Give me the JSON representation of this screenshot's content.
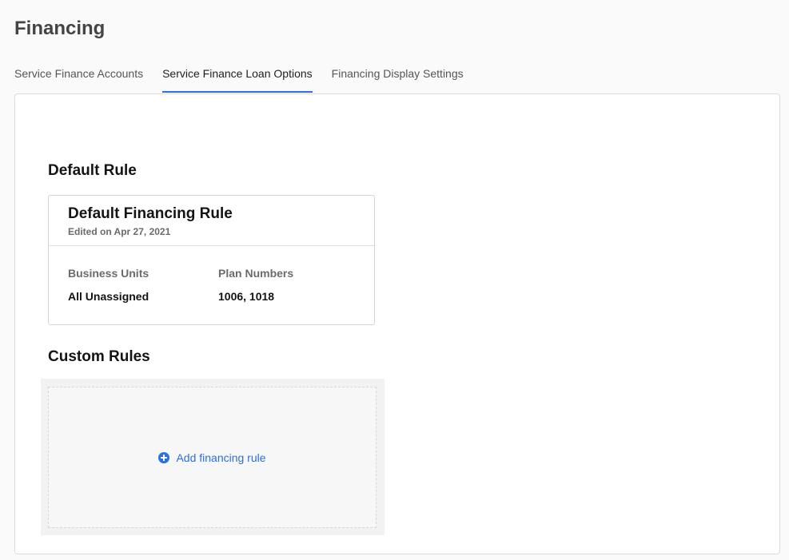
{
  "page": {
    "title": "Financing"
  },
  "tabs": [
    {
      "label": "Service Finance Accounts",
      "active": false
    },
    {
      "label": "Service Finance Loan Options",
      "active": true
    },
    {
      "label": "Financing Display Settings",
      "active": false
    }
  ],
  "default_rule": {
    "section_title": "Default Rule",
    "name": "Default Financing Rule",
    "edited": "Edited on Apr 27, 2021",
    "business_units_label": "Business Units",
    "business_units_value": "All Unassigned",
    "plan_numbers_label": "Plan Numbers",
    "plan_numbers_value": "1006, 1018"
  },
  "custom_rules": {
    "section_title": "Custom Rules",
    "add_label": "Add financing rule",
    "add_icon": "plus-circle-icon"
  },
  "colors": {
    "accent": "#2b6ee6",
    "background": "#fafafa",
    "panel": "#ffffff"
  }
}
